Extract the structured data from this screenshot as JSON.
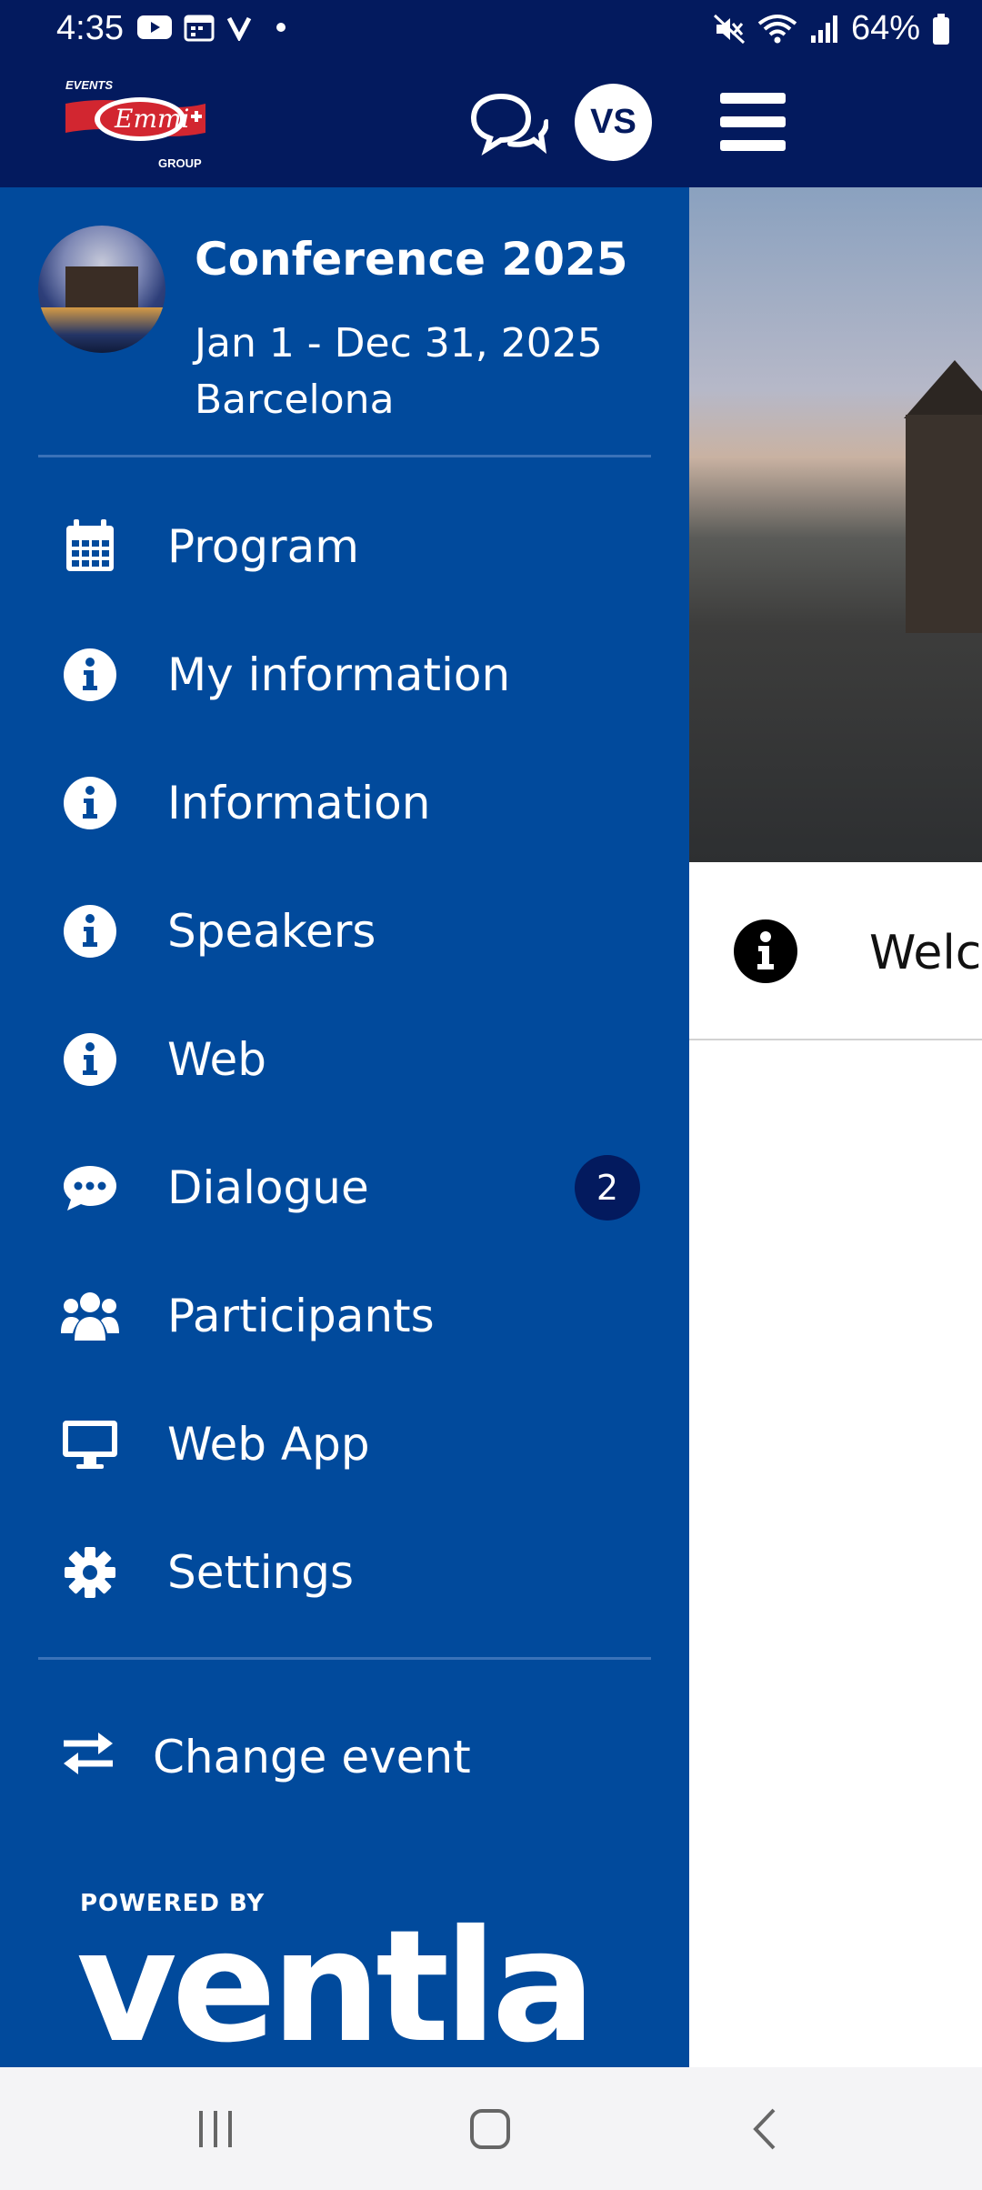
{
  "status_bar": {
    "time": "4:35",
    "battery": "64%"
  },
  "header": {
    "logo": {
      "top_text": "EVENTS",
      "brand": "Emmi",
      "bottom_text": "GROUP"
    },
    "avatar_initials": "VS"
  },
  "event": {
    "title": "Conference 2025",
    "dates": "Jan 1 - Dec 31, 2025",
    "city": "Barcelona"
  },
  "menu": [
    {
      "label": "Program",
      "icon": "calendar-icon"
    },
    {
      "label": "My information",
      "icon": "info-icon"
    },
    {
      "label": "Information",
      "icon": "info-icon"
    },
    {
      "label": "Speakers",
      "icon": "info-icon"
    },
    {
      "label": "Web",
      "icon": "info-icon"
    },
    {
      "label": "Dialogue",
      "icon": "chat-icon",
      "badge": "2"
    },
    {
      "label": "Participants",
      "icon": "users-icon"
    },
    {
      "label": "Web App",
      "icon": "desktop-icon"
    },
    {
      "label": "Settings",
      "icon": "gear-icon"
    }
  ],
  "change_event": {
    "label": "Change event",
    "icon": "swap-icon"
  },
  "footer": {
    "powered_by": "POWERED BY",
    "brand": "ventla"
  },
  "content": {
    "welcome_partial": "Welco"
  },
  "colors": {
    "header_bg": "#031a5e",
    "drawer_bg": "#014a9c",
    "badge_bg": "#031a5e"
  }
}
